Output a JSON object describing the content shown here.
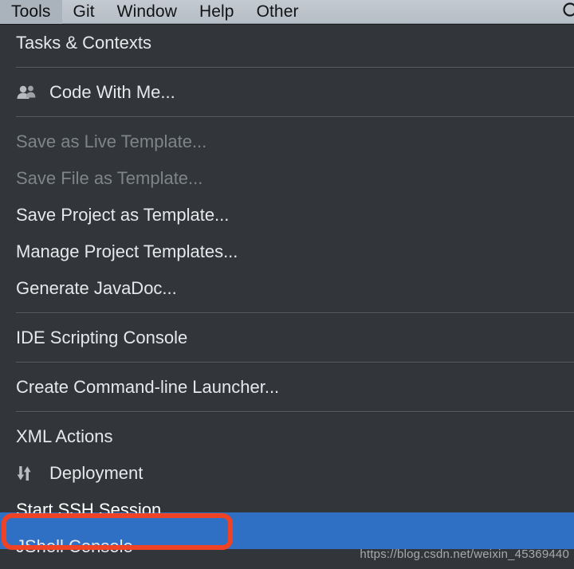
{
  "menubar": {
    "items": [
      {
        "label": "Tools",
        "active": true
      },
      {
        "label": "Git",
        "active": false
      },
      {
        "label": "Window",
        "active": false
      },
      {
        "label": "Help",
        "active": false
      },
      {
        "label": "Other",
        "active": false
      }
    ],
    "right_icon": "search-icon"
  },
  "menu": {
    "items": [
      {
        "type": "item",
        "label": "Tasks & Contexts",
        "icon": null,
        "state": "normal"
      },
      {
        "type": "separator"
      },
      {
        "type": "item",
        "label": "Code With Me...",
        "icon": "users-icon",
        "state": "normal"
      },
      {
        "type": "separator"
      },
      {
        "type": "item",
        "label": "Save as Live Template...",
        "icon": null,
        "state": "disabled"
      },
      {
        "type": "item",
        "label": "Save File as Template...",
        "icon": null,
        "state": "disabled"
      },
      {
        "type": "item",
        "label": "Save Project as Template...",
        "icon": null,
        "state": "normal"
      },
      {
        "type": "item",
        "label": "Manage Project Templates...",
        "icon": null,
        "state": "normal"
      },
      {
        "type": "item",
        "label": "Generate JavaDoc...",
        "icon": null,
        "state": "normal"
      },
      {
        "type": "separator"
      },
      {
        "type": "item",
        "label": "IDE Scripting Console",
        "icon": null,
        "state": "normal"
      },
      {
        "type": "separator"
      },
      {
        "type": "item",
        "label": "Create Command-line Launcher...",
        "icon": null,
        "state": "normal"
      },
      {
        "type": "separator"
      },
      {
        "type": "item",
        "label": "XML Actions",
        "icon": null,
        "state": "normal"
      },
      {
        "type": "item",
        "label": "Deployment",
        "icon": "sync-arrows-icon",
        "state": "normal"
      },
      {
        "type": "item",
        "label": "Start SSH Session...",
        "icon": null,
        "state": "selected"
      },
      {
        "type": "item",
        "label": "JShell Console",
        "icon": null,
        "state": "normal"
      }
    ]
  },
  "annotation": {
    "target_label": "Start SSH Session...",
    "color": "#f04224"
  },
  "watermark": {
    "text": "https://blog.csdn.net/weixin_45369440"
  },
  "colors": {
    "menu_background": "#32363a",
    "menubar_background": "#bcc3cb",
    "selection_blue": "#3070c4",
    "text_primary": "#e6e8ea",
    "text_disabled": "#7f8488",
    "annotation_red": "#f04224"
  }
}
